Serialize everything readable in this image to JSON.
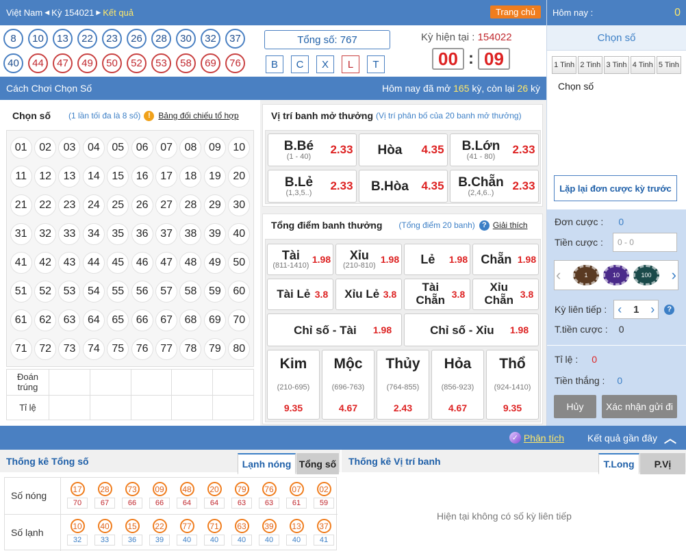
{
  "header": {
    "region": "Việt Nam",
    "period_label": "Kỳ 154021",
    "result_link": "Kết quả",
    "home_button": "Trang chủ"
  },
  "drawn_balls": [
    "8",
    "10",
    "13",
    "22",
    "23",
    "26",
    "28",
    "30",
    "32",
    "37",
    "40",
    "44",
    "47",
    "49",
    "50",
    "52",
    "53",
    "58",
    "69",
    "76"
  ],
  "total_box": "Tổng số: 767",
  "letter_buttons": [
    "B",
    "C",
    "X",
    "L",
    "T"
  ],
  "current_period": {
    "label": "Kỳ hiện tại :",
    "value": "154022",
    "minutes": "00",
    "separator": ":",
    "seconds": "09"
  },
  "subbar": {
    "title": "Cách Chơi Chọn Số",
    "status_prefix": "Hôm nay đã mở",
    "opened": "165",
    "status_mid": "kỳ, còn lại",
    "remaining": "26",
    "status_suffix": "kỳ"
  },
  "pick_section": {
    "title": "Chọn số",
    "hint": "(1 lần tối đa là 8 số)",
    "compare_link": "Bảng đối chiếu tổ hợp",
    "numbers": [
      "01",
      "02",
      "03",
      "04",
      "05",
      "06",
      "07",
      "08",
      "09",
      "10",
      "11",
      "12",
      "13",
      "14",
      "15",
      "16",
      "17",
      "18",
      "19",
      "20",
      "21",
      "22",
      "23",
      "24",
      "25",
      "26",
      "27",
      "28",
      "29",
      "30",
      "31",
      "32",
      "33",
      "34",
      "35",
      "36",
      "37",
      "38",
      "39",
      "40",
      "41",
      "42",
      "43",
      "44",
      "45",
      "46",
      "47",
      "48",
      "49",
      "50",
      "51",
      "52",
      "53",
      "54",
      "55",
      "56",
      "57",
      "58",
      "59",
      "60",
      "61",
      "62",
      "63",
      "64",
      "65",
      "66",
      "67",
      "68",
      "69",
      "70",
      "71",
      "72",
      "73",
      "74",
      "75",
      "76",
      "77",
      "78",
      "79",
      "80"
    ],
    "guess_label": "Đoán trúng",
    "rate_label": "Tỉ lệ"
  },
  "position_section": {
    "title": "Vị trí banh mở thưởng",
    "hint": "(Vị trí phân bố của 20 banh mở thưởng)",
    "cards": [
      {
        "name": "B.Bé",
        "sub": "(1 - 40)",
        "odd": "2.33"
      },
      {
        "name": "Hòa",
        "sub": "",
        "odd": "4.35"
      },
      {
        "name": "B.Lớn",
        "sub": "(41 - 80)",
        "odd": "2.33"
      },
      {
        "name": "B.Lẻ",
        "sub": "(1,3,5..)",
        "odd": "2.33"
      },
      {
        "name": "B.Hòa",
        "sub": "",
        "odd": "4.35"
      },
      {
        "name": "B.Chẵn",
        "sub": "(2,4,6..)",
        "odd": "2.33"
      }
    ]
  },
  "total_section": {
    "title": "Tổng điểm banh thưởng",
    "hint": "(Tổng điểm 20 banh)",
    "explain_link": "Giải thích",
    "row1": [
      {
        "name": "Tài",
        "sub": "(811-1410)",
        "odd": "1.98"
      },
      {
        "name": "Xỉu",
        "sub": "(210-810)",
        "odd": "1.98"
      },
      {
        "name": "Lẻ",
        "sub": "",
        "odd": "1.98"
      },
      {
        "name": "Chẵn",
        "sub": "",
        "odd": "1.98"
      }
    ],
    "row2": [
      {
        "name": "Tài Lẻ",
        "odd": "3.8"
      },
      {
        "name": "Xỉu Lẻ",
        "odd": "3.8"
      },
      {
        "name": "Tài Chẵn",
        "odd": "3.8"
      },
      {
        "name": "Xỉu Chẵn",
        "odd": "3.8"
      }
    ],
    "row3": [
      {
        "name": "Chỉ số - Tài",
        "odd": "1.98"
      },
      {
        "name": "Chỉ số - Xỉu",
        "odd": "1.98"
      }
    ],
    "elements": [
      {
        "name": "Kim",
        "range": "(210-695)",
        "odd": "9.35"
      },
      {
        "name": "Mộc",
        "range": "(696-763)",
        "odd": "4.67"
      },
      {
        "name": "Thủy",
        "range": "(764-855)",
        "odd": "2.43"
      },
      {
        "name": "Hỏa",
        "range": "(856-923)",
        "odd": "4.67"
      },
      {
        "name": "Thổ",
        "range": "(924-1410)",
        "odd": "9.35"
      }
    ]
  },
  "right_panel": {
    "today_label": "Hôm nay :",
    "today_value": "0",
    "pick_header": "Chọn số",
    "tinh_tabs": [
      "1 Tinh",
      "2 Tinh",
      "3 Tinh",
      "4 Tinh",
      "5 Tinh"
    ],
    "pick_label": "Chọn số",
    "repeat_button": "Lặp lại đơn cược kỳ trước",
    "bet_label": "Đơn cược :",
    "bet_value": "0",
    "amount_label": "Tiền cược :",
    "amount_placeholder": "0 - 0",
    "chips": [
      "1",
      "10",
      "100"
    ],
    "consecutive_label": "Kỳ liên tiếp :",
    "consecutive_value": "1",
    "total_label": "T.tiền cược :",
    "total_value": "0",
    "rate_label": "Tỉ lệ :",
    "rate_value": "0",
    "win_label": "Tiền thắng :",
    "win_value": "0",
    "cancel_button": "Hủy",
    "confirm_button": "Xác nhận gửi đi"
  },
  "bottombar": {
    "analysis_link": "Phân tích",
    "recent_results": "Kết quả gần đây"
  },
  "stats": {
    "total_title": "Thống kê Tổng số",
    "tab_hotcold": "Lạnh nóng",
    "tab_total": "Tổng số",
    "hot_label": "Số nóng",
    "cold_label": "Số lạnh",
    "hot_numbers": [
      "17",
      "28",
      "73",
      "09",
      "48",
      "20",
      "79",
      "76",
      "07",
      "02"
    ],
    "hot_counts": [
      "70",
      "67",
      "66",
      "66",
      "64",
      "64",
      "63",
      "63",
      "61",
      "59"
    ],
    "cold_numbers": [
      "10",
      "40",
      "15",
      "22",
      "77",
      "71",
      "63",
      "39",
      "13",
      "37"
    ],
    "cold_counts": [
      "32",
      "33",
      "36",
      "39",
      "40",
      "40",
      "40",
      "40",
      "40",
      "41"
    ],
    "position_title": "Thống kê Vị trí banh",
    "tab_long": "T.Long",
    "tab_pvi": "P.Vị",
    "empty_message": "Hiện tại không có số kỳ liên tiếp"
  },
  "colors": {
    "primary": "#4a80c2",
    "accent_yellow": "#ffe86a",
    "odd_red": "#d22",
    "orange": "#f07d1d"
  }
}
